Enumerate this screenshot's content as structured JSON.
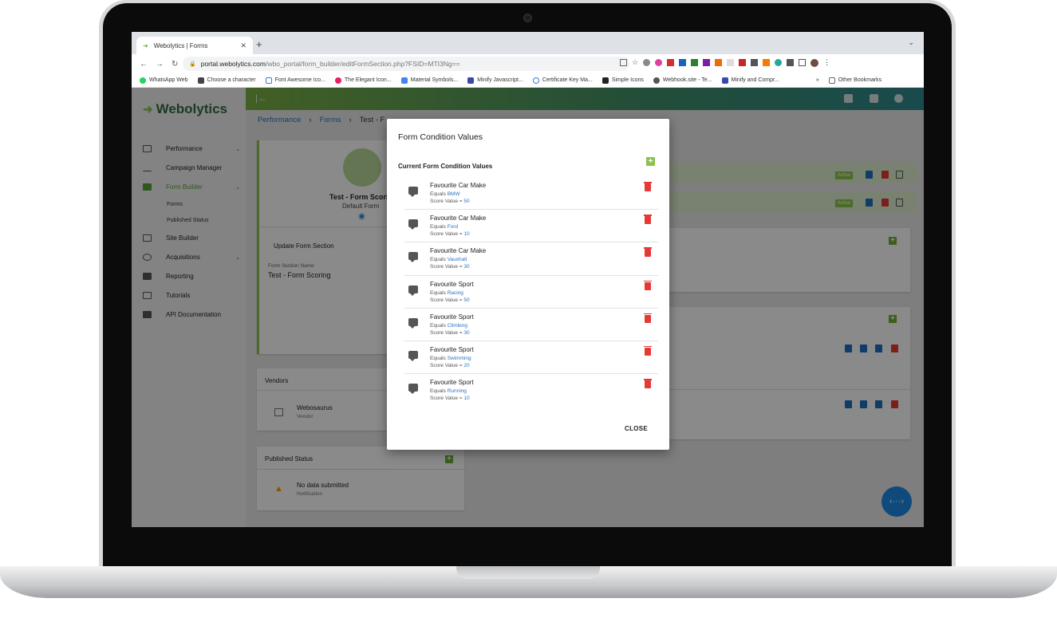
{
  "browser": {
    "tab_title": "Webolytics | Forms",
    "url_domain": "portal.webolytics.com",
    "url_path": "/wbo_portal/form_builder/editFormSection.php?FSID=MTI3Ng==",
    "bookmarks": [
      "WhatsApp Web",
      "Choose a character",
      "Font Awesome Ico...",
      "The Elegant Icon...",
      "Material Symbols...",
      "Minify Javascript...",
      "Certificate Key Ma...",
      "Simple Icons",
      "Webhook.site - Te...",
      "Minify and Compr..."
    ],
    "other_bookmarks": "Other Bookmarks"
  },
  "app": {
    "logo": "Webolytics",
    "nav": [
      "Performance",
      "Campaign Manager",
      "Form Builder",
      "Site Builder",
      "Acquisitions",
      "Reporting",
      "Tutorials",
      "API Documentation"
    ],
    "subnav": [
      "Forms",
      "Published Status"
    ],
    "breadcrumb": [
      "Performance",
      "Forms",
      "Test - F"
    ],
    "form_name": "Test - Form Scori",
    "form_type": "Default Form",
    "update_section_title": "Update Form Section",
    "section_name_label": "Form Section Name",
    "section_name_value": "Test - Form Scoring",
    "vendors_title": "Vendors",
    "vendor_name": "Webosaurus",
    "vendor_role": "Vendor",
    "published_title": "Published Status",
    "published_msg": "No data submitted",
    "published_sub": "Notification",
    "badge_active": "Active",
    "fab_label": "‹···›"
  },
  "modal": {
    "title": "Form Condition Values",
    "subtitle": "Current Form Condition Values",
    "close": "CLOSE",
    "items": [
      {
        "name": "Favourite Car Make",
        "equals_label": "Equals",
        "equals": "BMW",
        "score_label": "Score Value =",
        "score": "50"
      },
      {
        "name": "Favourite Car Make",
        "equals_label": "Equals",
        "equals": "Ford",
        "score_label": "Score Value =",
        "score": "10"
      },
      {
        "name": "Favourite Car Make",
        "equals_label": "Equals",
        "equals": "Vauxhall",
        "score_label": "Score Value =",
        "score": "30"
      },
      {
        "name": "Favourite Sport",
        "equals_label": "Equals",
        "equals": "Racing",
        "score_label": "Score Value =",
        "score": "50"
      },
      {
        "name": "Favourite Sport",
        "equals_label": "Equals",
        "equals": "Climbing",
        "score_label": "Score Value =",
        "score": "30"
      },
      {
        "name": "Favourite Sport",
        "equals_label": "Equals",
        "equals": "Swimming",
        "score_label": "Score Value =",
        "score": "20"
      },
      {
        "name": "Favourite Sport",
        "equals_label": "Equals",
        "equals": "Running",
        "score_label": "Score Value =",
        "score": "10"
      }
    ]
  },
  "colors": {
    "brand_green": "#8cc44b",
    "link_blue": "#2a72c4",
    "delete_red": "#e53935"
  }
}
